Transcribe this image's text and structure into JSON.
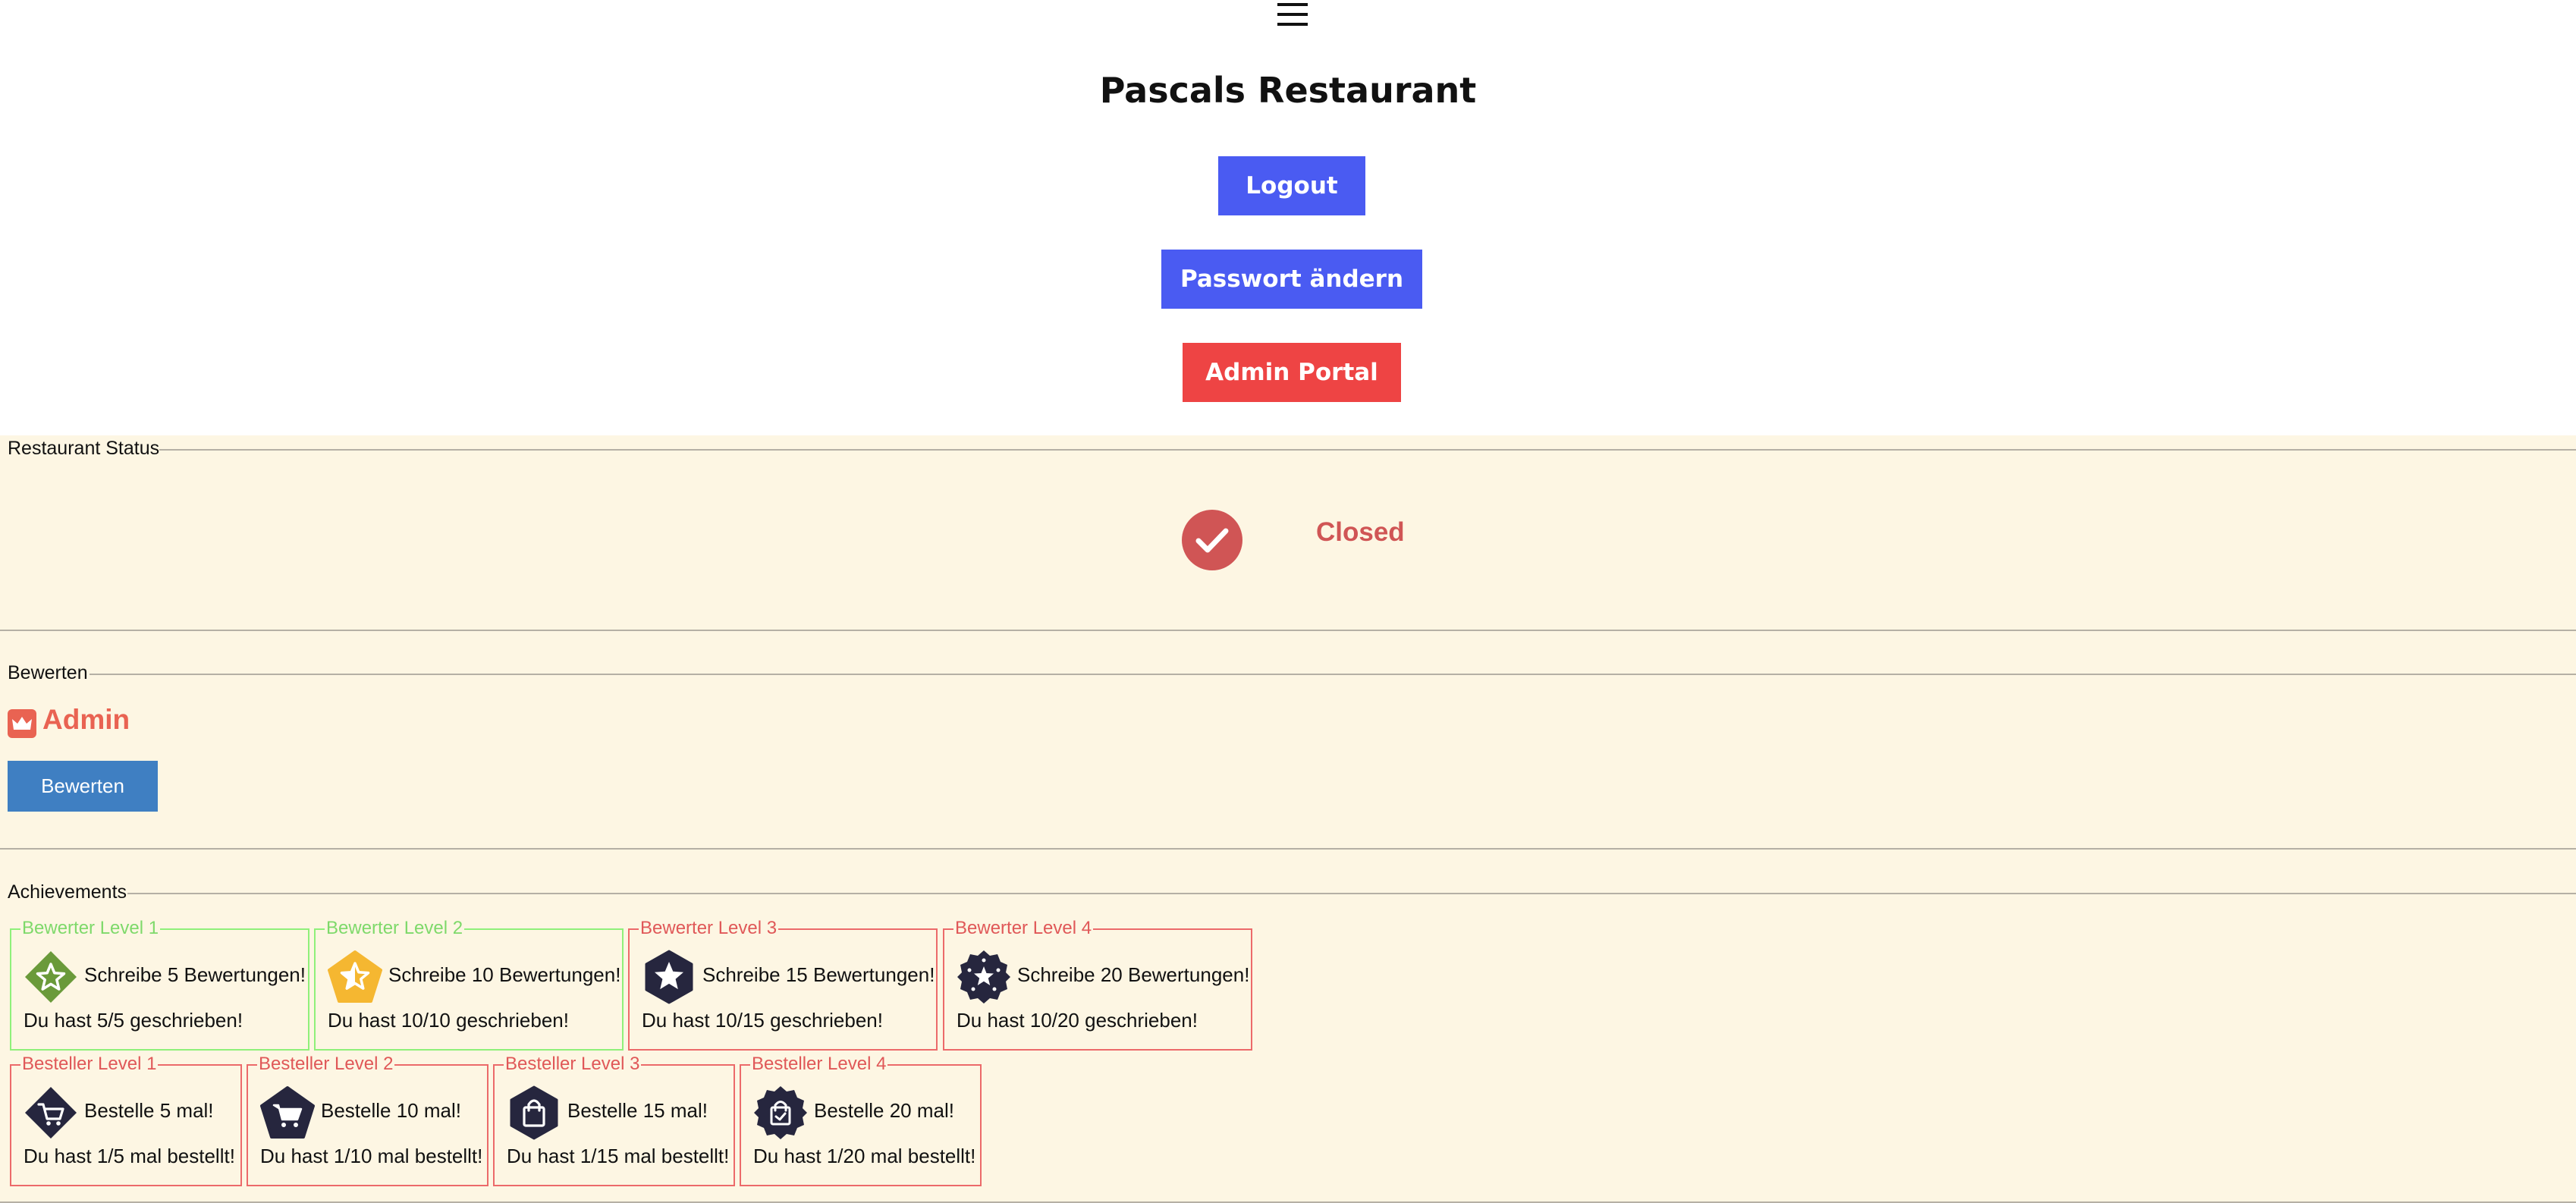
{
  "header": {
    "title": "Pascals Restaurant",
    "logout_label": "Logout",
    "password_label": "Passwort ändern",
    "admin_label": "Admin Portal"
  },
  "status_section": {
    "legend": "Restaurant Status",
    "status": "Closed",
    "status_color": "#d05555"
  },
  "rating_section": {
    "legend": "Bewerten",
    "role": "Admin",
    "role_icon": "crown-icon",
    "button_label": "Bewerten"
  },
  "achievements_section": {
    "legend": "Achievements",
    "items": [
      {
        "title": "Bewerter Level 1",
        "goal": "Schreibe 5 Bewertungen!",
        "progress": "Du hast 5/5 geschrieben!",
        "done": true,
        "icon": "star-diamond-icon",
        "icon_color": "#6a9a3a"
      },
      {
        "title": "Bewerter Level 2",
        "goal": "Schreibe 10 Bewertungen!",
        "progress": "Du hast 10/10 geschrieben!",
        "done": true,
        "icon": "half-star-pentagon-icon",
        "icon_color": "#f5b731"
      },
      {
        "title": "Bewerter Level 3",
        "goal": "Schreibe 15 Bewertungen!",
        "progress": "Du hast 10/15 geschrieben!",
        "done": false,
        "icon": "star-hexagon-icon",
        "icon_color": "#26263e"
      },
      {
        "title": "Bewerter Level 4",
        "goal": "Schreibe 20 Bewertungen!",
        "progress": "Du hast 10/20 geschrieben!",
        "done": false,
        "icon": "star-seal-icon",
        "icon_color": "#26263e"
      },
      {
        "title": "Besteller Level 1",
        "goal": "Bestelle 5 mal!",
        "progress": "Du hast 1/5 mal bestellt!",
        "done": false,
        "icon": "cart-diamond-icon",
        "icon_color": "#26263e"
      },
      {
        "title": "Besteller Level 2",
        "goal": "Bestelle 10 mal!",
        "progress": "Du hast 1/10 mal bestellt!",
        "done": false,
        "icon": "cart-pentagon-icon",
        "icon_color": "#26263e"
      },
      {
        "title": "Besteller Level 3",
        "goal": "Bestelle 15 mal!",
        "progress": "Du hast 1/15 mal bestellt!",
        "done": false,
        "icon": "bag-hexagon-icon",
        "icon_color": "#26263e"
      },
      {
        "title": "Besteller Level 4",
        "goal": "Bestelle 20 mal!",
        "progress": "Du hast 1/20 mal bestellt!",
        "done": false,
        "icon": "bag-seal-icon",
        "icon_color": "#26263e"
      }
    ]
  },
  "colors": {
    "primary_button": "#4a5bf2",
    "danger_button": "#ee4444",
    "rate_button": "#3f7fc2",
    "section_bg": "#fdf6e3",
    "achieved_border": "#8ff07a",
    "pending_border": "#ec6a6a"
  }
}
